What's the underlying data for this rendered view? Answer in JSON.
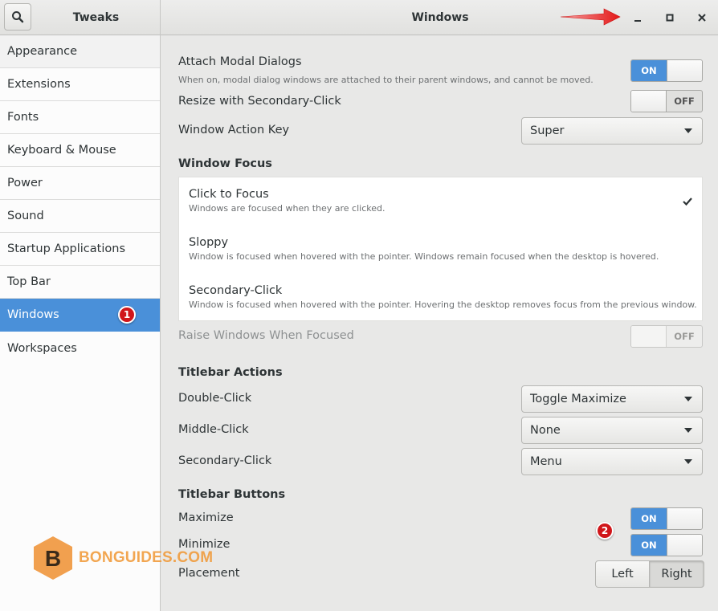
{
  "app": {
    "sidebar_title": "Tweaks",
    "window_title": "Windows"
  },
  "icons": {
    "search": "search-icon",
    "minimize": "minimize-icon",
    "maximize": "maximize-icon",
    "close": "close-icon",
    "check": "check-icon",
    "dropdown": "chevron-down-icon"
  },
  "colors": {
    "accent": "#4a90d9",
    "badge": "#d0161a",
    "arrow": "#e32020",
    "watermark": "#f0963c"
  },
  "sidebar": {
    "items": [
      {
        "label": "Appearance"
      },
      {
        "label": "Extensions"
      },
      {
        "label": "Fonts"
      },
      {
        "label": "Keyboard & Mouse"
      },
      {
        "label": "Power"
      },
      {
        "label": "Sound"
      },
      {
        "label": "Startup Applications"
      },
      {
        "label": "Top Bar"
      },
      {
        "label": "Windows",
        "badge": "1"
      },
      {
        "label": "Workspaces"
      }
    ],
    "selected": "Windows"
  },
  "settings": {
    "attach_modal": {
      "label": "Attach Modal Dialogs",
      "description": "When on, modal dialog windows are attached to their parent windows, and cannot be moved.",
      "state": "ON"
    },
    "resize_secondary": {
      "label": "Resize with Secondary-Click",
      "state": "OFF"
    },
    "window_action_key": {
      "label": "Window Action Key",
      "value": "Super"
    },
    "window_focus": {
      "heading": "Window Focus",
      "options": [
        {
          "title": "Click to Focus",
          "description": "Windows are focused when they are clicked.",
          "selected": true
        },
        {
          "title": "Sloppy",
          "description": "Window is focused when hovered with the pointer. Windows remain focused when the desktop is hovered."
        },
        {
          "title": "Secondary-Click",
          "description": "Window is focused when hovered with the pointer. Hovering the desktop removes focus from the previous window."
        }
      ]
    },
    "raise_windows": {
      "label": "Raise Windows When Focused",
      "state": "OFF"
    },
    "titlebar_actions": {
      "heading": "Titlebar Actions",
      "double_click": {
        "label": "Double-Click",
        "value": "Toggle Maximize"
      },
      "middle_click": {
        "label": "Middle-Click",
        "value": "None"
      },
      "secondary_click": {
        "label": "Secondary-Click",
        "value": "Menu"
      }
    },
    "titlebar_buttons": {
      "heading": "Titlebar Buttons",
      "maximize": {
        "label": "Maximize",
        "state": "ON"
      },
      "minimize": {
        "label": "Minimize",
        "state": "ON",
        "badge": "2"
      },
      "placement": {
        "label": "Placement",
        "left": "Left",
        "right": "Right",
        "selected": "Right"
      }
    }
  },
  "watermark": {
    "logo_letter": "B",
    "text": "BONGUIDES.COM"
  }
}
